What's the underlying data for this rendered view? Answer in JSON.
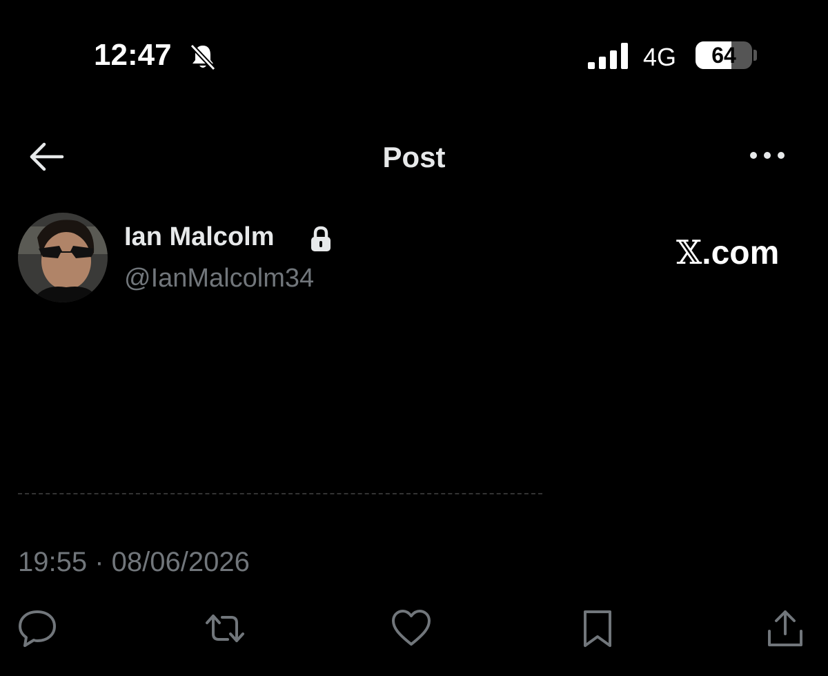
{
  "status_bar": {
    "time": "12:47",
    "network": "4G",
    "battery_percent": "64",
    "battery_level": 0.64,
    "icons": [
      "bell-muted-icon",
      "signal-bars-icon"
    ]
  },
  "header": {
    "title": "Post",
    "icons": [
      "back-arrow-icon",
      "more-options-icon"
    ]
  },
  "author": {
    "display_name": "Ian Malcolm",
    "handle": "@IanMalcolm34",
    "locked": true,
    "icons": [
      "lock-icon",
      "avatar"
    ]
  },
  "watermark": {
    "x_glyph": "𝕏",
    "suffix": ".com"
  },
  "post": {
    "line_1": "",
    "line_2": "",
    "timestamp": "19:55 · 08/06/2026"
  },
  "actions": [
    "reply-icon",
    "repost-icon",
    "like-icon",
    "bookmark-icon",
    "share-icon"
  ],
  "colors": {
    "background": "#000000",
    "primary_text": "#e7e9ea",
    "secondary_text": "#71767b"
  }
}
